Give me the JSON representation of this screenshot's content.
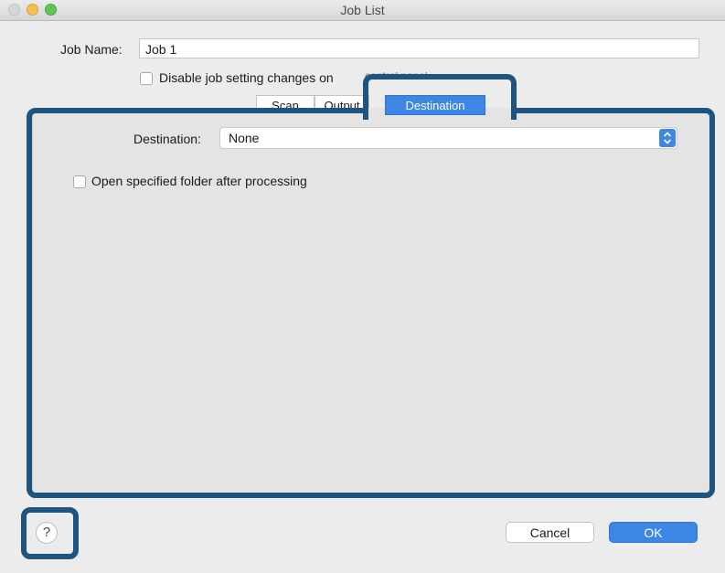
{
  "window": {
    "title": "Job List"
  },
  "job_name": {
    "label": "Job Name:",
    "value": "Job 1"
  },
  "disable_checkbox": {
    "label": "Disable job setting changes on control panel",
    "visible_label": "Disable job setting changes on",
    "obscured_tail": "control panel.",
    "checked": false
  },
  "tabs": [
    {
      "label": "Scan",
      "active": false
    },
    {
      "label": "Output",
      "active": false
    },
    {
      "label": "Destination",
      "active": true
    }
  ],
  "destination": {
    "label": "Destination:",
    "selected": "None",
    "stepper_symbol": "⌃⌄"
  },
  "open_folder_checkbox": {
    "label": "Open specified folder after processing",
    "checked": false
  },
  "buttons": {
    "cancel": "Cancel",
    "ok": "OK",
    "help": "?"
  },
  "colors": {
    "accent": "#3e86e4",
    "highlight": "#1d5480",
    "panel": "#e4e4e4"
  }
}
